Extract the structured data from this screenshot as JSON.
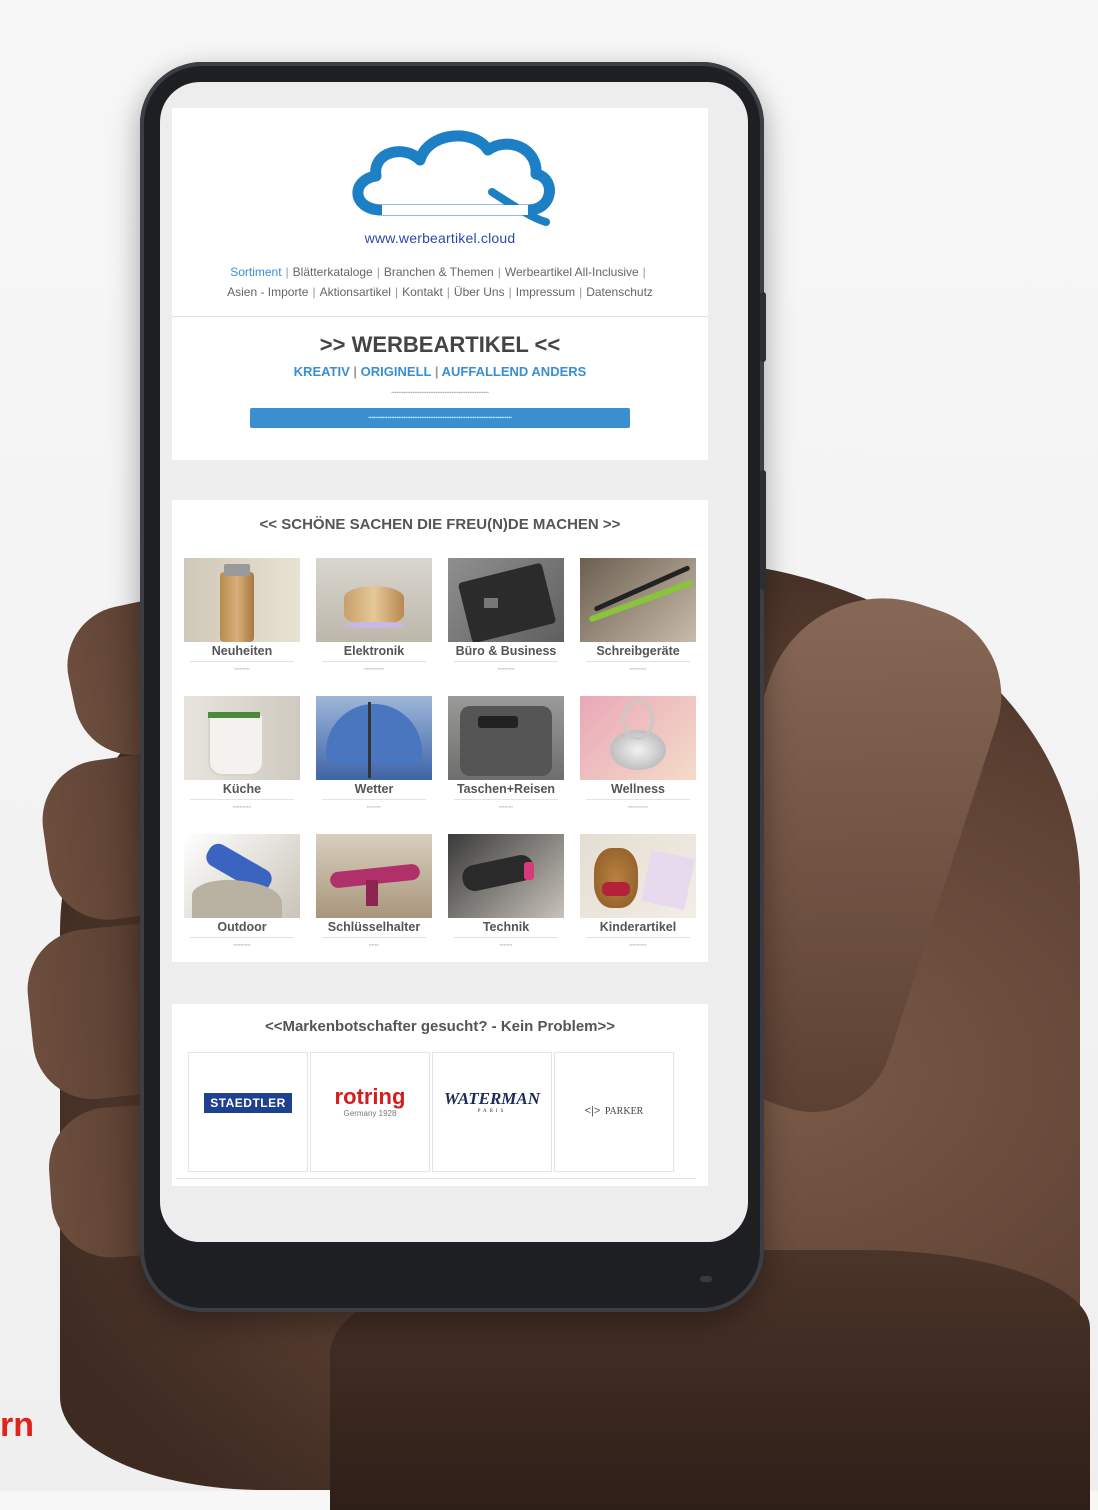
{
  "logo": {
    "url_text": "www.werbeartikel.cloud"
  },
  "nav": {
    "items": [
      {
        "label": "Sortiment",
        "active": true
      },
      {
        "label": "Blätterkataloge"
      },
      {
        "label": "Branchen & Themen"
      },
      {
        "label": "Werbeartikel All-Inclusive"
      },
      {
        "label": "Asien - Importe"
      },
      {
        "label": "Aktionsartikel"
      },
      {
        "label": "Kontakt"
      },
      {
        "label": "Über Uns"
      },
      {
        "label": "Impressum"
      },
      {
        "label": "Datenschutz"
      }
    ]
  },
  "hero": {
    "title": ">> WERBEARTIKEL <<",
    "sub1": "KREATIV",
    "sub2": "ORIGINELL",
    "sub3": "AUFFALLEND ANDERS",
    "sep": "|"
  },
  "categories": {
    "title": "<< SCHÖNE SACHEN DIE FREU(N)DE MACHEN >>",
    "items": [
      {
        "label": "Neuheiten"
      },
      {
        "label": "Elektronik"
      },
      {
        "label": "Büro & Business"
      },
      {
        "label": "Schreibgeräte"
      },
      {
        "label": "Küche"
      },
      {
        "label": "Wetter"
      },
      {
        "label": "Taschen+Reisen"
      },
      {
        "label": "Wellness"
      },
      {
        "label": "Outdoor"
      },
      {
        "label": "Schlüsselhalter"
      },
      {
        "label": "Technik"
      },
      {
        "label": "Kinderartikel"
      }
    ]
  },
  "brands": {
    "title": "<<Markenbotschafter gesucht? - Kein Problem>>",
    "items": [
      {
        "name": "STAEDTLER"
      },
      {
        "name": "rotring",
        "sub": "Germany 1928"
      },
      {
        "name": "WATERMAN",
        "sub": "PARIS"
      },
      {
        "name": "PARKER"
      }
    ]
  },
  "corner": {
    "text": "rn"
  },
  "colors": {
    "accent": "#3a8fd1",
    "logo_blue": "#2a4aa8",
    "corner_red": "#e0241b"
  }
}
